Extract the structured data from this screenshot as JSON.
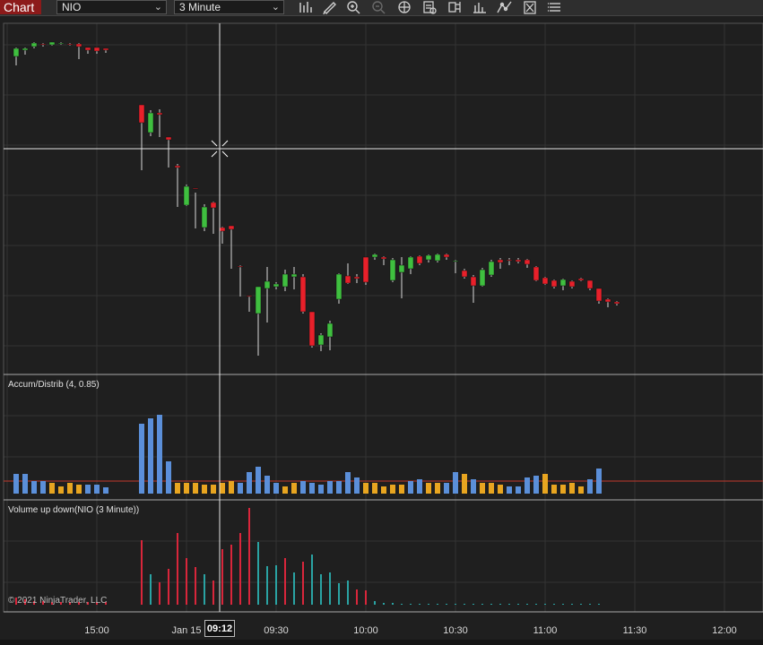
{
  "toolbar": {
    "chart_tab": "Chart",
    "instrument": "NIO",
    "interval": "3 Minute",
    "tools": [
      "bar-type-icon",
      "draw-pencil-icon",
      "zoom-in-icon",
      "zoom-out-icon",
      "crosshair-grid-icon",
      "properties-icon",
      "data-box-icon",
      "indicators-icon",
      "strategies-icon",
      "close-chart-icon",
      "menu-icon"
    ]
  },
  "panels": {
    "price": {
      "name": "NIO price"
    },
    "accum": {
      "label": "Accum/Distrib (4, 0.85)"
    },
    "volume": {
      "label": "Volume up down(NIO (3 Minute))"
    }
  },
  "copyright": "© 2021 NinjaTrader, LLC",
  "x_axis": {
    "ticks": [
      "15:00",
      "Jan 15",
      "09:30",
      "10:00",
      "10:30",
      "11:00",
      "11:30",
      "12:00"
    ],
    "cursor_time": "09:12"
  },
  "colors": {
    "up": "#3fbf3f",
    "down": "#e8202a",
    "accum_up": "#5b8fd9",
    "accum_down": "#e8a520",
    "vol_up": "#2aa3a3",
    "vol_down": "#d9263b",
    "crosshair": "#e6e6e6",
    "grid": "#333333"
  },
  "chart_data": {
    "type": "candlestick",
    "candles": [
      [
        63,
        73,
        54,
        53,
        1
      ],
      [
        56,
        61,
        54,
        53,
        1
      ],
      [
        52,
        54,
        48,
        47,
        1
      ],
      [
        50,
        52,
        49,
        48,
        0
      ],
      [
        50,
        51,
        47,
        47,
        1
      ],
      [
        49,
        50,
        48,
        47,
        1
      ],
      [
        50,
        51,
        49,
        48,
        0
      ],
      [
        52,
        66,
        49,
        48,
        0
      ],
      [
        56,
        60,
        53,
        53,
        0
      ],
      [
        57,
        60,
        53,
        53,
        0
      ],
      [
        56,
        59,
        54,
        54,
        0
      ],
      [
        null,
        null,
        null,
        null,
        null
      ],
      [
        null,
        null,
        null,
        null,
        null
      ],
      [
        null,
        null,
        null,
        null,
        null
      ],
      [
        137,
        190,
        117,
        117,
        0
      ],
      [
        148,
        152,
        126,
        123,
        1
      ],
      [
        128,
        153,
        126,
        122,
        0
      ],
      [
        156,
        187,
        153,
        155,
        0
      ],
      [
        187,
        231,
        185,
        183,
        0
      ],
      [
        229,
        230,
        208,
        206,
        1
      ],
      [
        211,
        255,
        210,
        215,
        0
      ],
      [
        254,
        258,
        231,
        228,
        1
      ],
      [
        232,
        261,
        226,
        225,
        0
      ],
      [
        258,
        272,
        254,
        253,
        0
      ],
      [
        256,
        300,
        252,
        255,
        0
      ],
      [
        298,
        331,
        297,
        296,
        0
      ],
      [
        330,
        348,
        330,
        330,
        0
      ],
      [
        350,
        397,
        320,
        320,
        1
      ],
      [
        322,
        360,
        314,
        298,
        1
      ],
      [
        320,
        323,
        317,
        315,
        1
      ],
      [
        320,
        325,
        306,
        301,
        1
      ],
      [
        309,
        323,
        306,
        298,
        1
      ],
      [
        348,
        350,
        309,
        306,
        0
      ],
      [
        386,
        388,
        348,
        348,
        0
      ],
      [
        385,
        392,
        374,
        372,
        1
      ],
      [
        376,
        391,
        361,
        358,
        1
      ],
      [
        334,
        339,
        306,
        305,
        1
      ],
      [
        316,
        317,
        308,
        294,
        0
      ],
      [
        311,
        316,
        309,
        306,
        0
      ],
      [
        315,
        318,
        287,
        287,
        0
      ],
      [
        287,
        290,
        284,
        283,
        1
      ],
      [
        289,
        296,
        287,
        286,
        0
      ],
      [
        313,
        315,
        290,
        288,
        1
      ],
      [
        304,
        333,
        296,
        287,
        1
      ],
      [
        300,
        306,
        287,
        286,
        1
      ],
      [
        294,
        296,
        286,
        285,
        0
      ],
      [
        290,
        293,
        285,
        284,
        1
      ],
      [
        291,
        293,
        284,
        283,
        1
      ],
      [
        287,
        290,
        284,
        283,
        0
      ],
      [
        292,
        305,
        291,
        290,
        1
      ],
      [
        309,
        311,
        302,
        300,
        0
      ],
      [
        319,
        338,
        309,
        307,
        0
      ],
      [
        319,
        320,
        301,
        299,
        1
      ],
      [
        307,
        309,
        292,
        290,
        1
      ],
      [
        293,
        300,
        290,
        288,
        0
      ],
      [
        291,
        296,
        290,
        288,
        0
      ],
      [
        292,
        294,
        290,
        288,
        0
      ],
      [
        295,
        299,
        290,
        289,
        0
      ],
      [
        313,
        314,
        298,
        297,
        0
      ],
      [
        317,
        318,
        310,
        309,
        0
      ],
      [
        320,
        322,
        313,
        312,
        0
      ],
      [
        319,
        324,
        312,
        311,
        1
      ],
      [
        320,
        322,
        314,
        313,
        0
      ],
      [
        313,
        314,
        311,
        310,
        0
      ],
      [
        322,
        324,
        313,
        313,
        0
      ],
      [
        336,
        339,
        322,
        322,
        0
      ],
      [
        337,
        343,
        334,
        333,
        0
      ],
      [
        339,
        341,
        337,
        336,
        0
      ]
    ],
    "accum_dist": [
      [
        1,
        22
      ],
      [
        1,
        22
      ],
      [
        1,
        14
      ],
      [
        1,
        14
      ],
      [
        0,
        12
      ],
      [
        0,
        8
      ],
      [
        0,
        12
      ],
      [
        0,
        10
      ],
      [
        1,
        10
      ],
      [
        1,
        10
      ],
      [
        1,
        7
      ],
      [
        0,
        0
      ],
      [
        0,
        0
      ],
      [
        0,
        0
      ],
      [
        1,
        78
      ],
      [
        1,
        84
      ],
      [
        1,
        88
      ],
      [
        1,
        36
      ],
      [
        0,
        12
      ],
      [
        0,
        12
      ],
      [
        0,
        12
      ],
      [
        0,
        10
      ],
      [
        0,
        10
      ],
      [
        0,
        12
      ],
      [
        0,
        14
      ],
      [
        1,
        12
      ],
      [
        1,
        24
      ],
      [
        1,
        30
      ],
      [
        1,
        20
      ],
      [
        1,
        12
      ],
      [
        0,
        8
      ],
      [
        0,
        12
      ],
      [
        1,
        14
      ],
      [
        1,
        12
      ],
      [
        1,
        10
      ],
      [
        1,
        14
      ],
      [
        1,
        14
      ],
      [
        1,
        24
      ],
      [
        1,
        18
      ],
      [
        0,
        12
      ],
      [
        0,
        12
      ],
      [
        0,
        8
      ],
      [
        0,
        10
      ],
      [
        0,
        10
      ],
      [
        1,
        14
      ],
      [
        1,
        16
      ],
      [
        0,
        12
      ],
      [
        0,
        12
      ],
      [
        1,
        12
      ],
      [
        1,
        24
      ],
      [
        0,
        22
      ],
      [
        1,
        16
      ],
      [
        0,
        12
      ],
      [
        0,
        12
      ],
      [
        0,
        10
      ],
      [
        1,
        8
      ],
      [
        1,
        8
      ],
      [
        1,
        18
      ],
      [
        1,
        20
      ],
      [
        0,
        22
      ],
      [
        0,
        10
      ],
      [
        0,
        10
      ],
      [
        0,
        12
      ],
      [
        0,
        8
      ],
      [
        1,
        16
      ],
      [
        1,
        28
      ]
    ],
    "volume": [
      [
        0,
        8
      ],
      [
        0,
        6
      ],
      [
        0,
        4
      ],
      [
        0,
        4
      ],
      [
        0,
        3
      ],
      [
        0,
        3
      ],
      [
        0,
        3
      ],
      [
        0,
        3
      ],
      [
        0,
        3
      ],
      [
        0,
        3
      ],
      [
        0,
        3
      ],
      [
        0,
        0
      ],
      [
        0,
        0
      ],
      [
        0,
        0
      ],
      [
        0,
        72
      ],
      [
        1,
        34
      ],
      [
        0,
        25
      ],
      [
        0,
        40
      ],
      [
        0,
        80
      ],
      [
        0,
        52
      ],
      [
        0,
        42
      ],
      [
        1,
        34
      ],
      [
        0,
        27
      ],
      [
        0,
        62
      ],
      [
        0,
        67
      ],
      [
        0,
        80
      ],
      [
        0,
        108
      ],
      [
        1,
        70
      ],
      [
        1,
        43
      ],
      [
        1,
        44
      ],
      [
        0,
        52
      ],
      [
        1,
        36
      ],
      [
        0,
        48
      ],
      [
        1,
        56
      ],
      [
        1,
        34
      ],
      [
        1,
        36
      ],
      [
        1,
        24
      ],
      [
        1,
        27
      ],
      [
        0,
        17
      ],
      [
        0,
        16
      ],
      [
        1,
        4
      ],
      [
        1,
        2
      ],
      [
        1,
        2
      ],
      [
        1,
        1
      ],
      [
        1,
        1
      ],
      [
        1,
        1
      ],
      [
        1,
        1
      ],
      [
        1,
        1
      ],
      [
        1,
        1
      ],
      [
        1,
        1
      ],
      [
        1,
        1
      ],
      [
        1,
        1
      ],
      [
        1,
        1
      ],
      [
        1,
        1
      ],
      [
        1,
        1
      ],
      [
        1,
        1
      ],
      [
        1,
        1
      ],
      [
        1,
        1
      ],
      [
        1,
        1
      ],
      [
        1,
        1
      ],
      [
        1,
        1
      ],
      [
        1,
        1
      ],
      [
        1,
        1
      ],
      [
        1,
        1
      ],
      [
        1,
        1
      ],
      [
        1,
        1
      ]
    ]
  }
}
